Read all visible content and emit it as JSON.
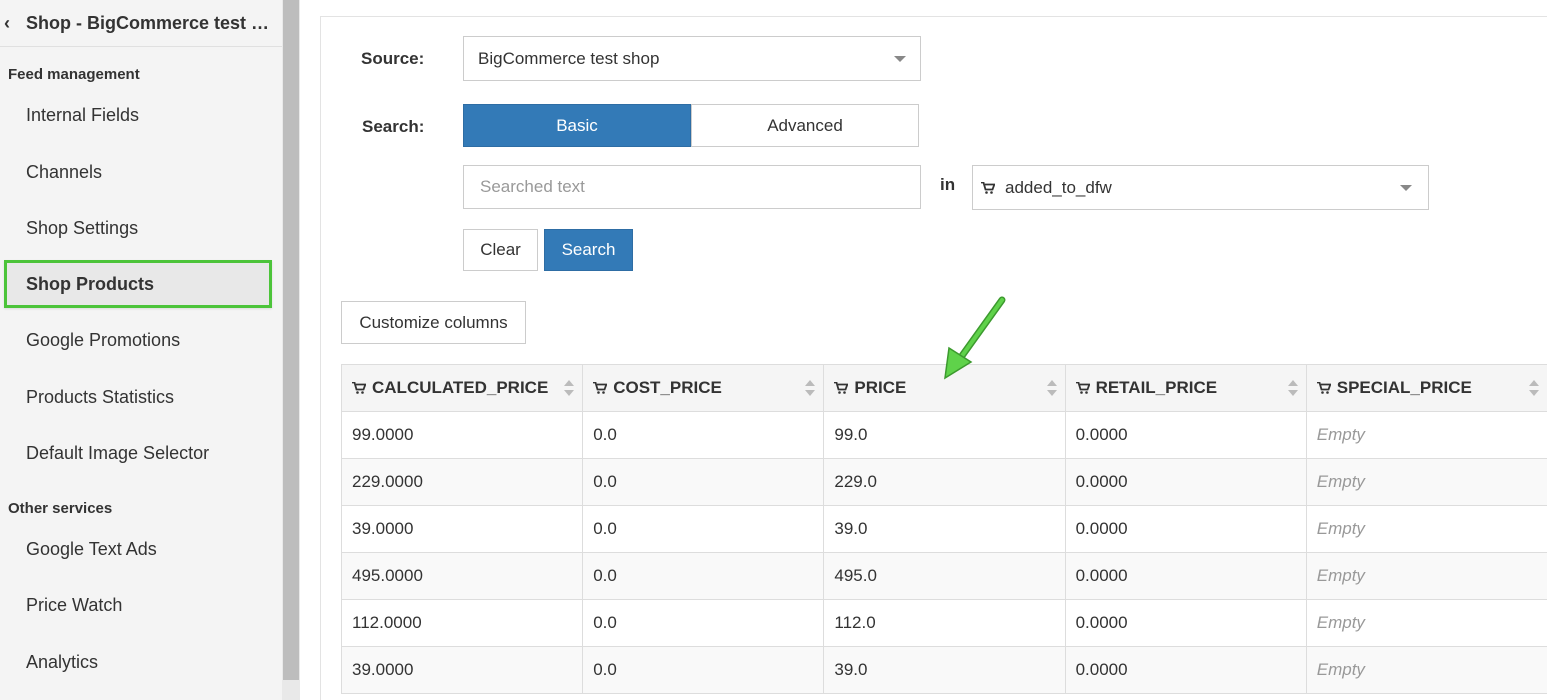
{
  "sidebar": {
    "shop_title": "Shop - BigCommerce test shop",
    "sections": [
      {
        "title": "Feed management",
        "items": [
          "Internal Fields",
          "Channels",
          "Shop Settings",
          "Shop Products",
          "Google Promotions",
          "Products Statistics",
          "Default Image Selector"
        ]
      },
      {
        "title": "Other services",
        "items": [
          "Google Text Ads",
          "Price Watch",
          "Analytics"
        ]
      }
    ],
    "active_item": "Shop Products"
  },
  "form": {
    "source_label": "Source:",
    "source_value": "BigCommerce test shop",
    "search_label": "Search:",
    "search_modes": [
      "Basic",
      "Advanced"
    ],
    "search_mode_selected": "Basic",
    "search_placeholder": "Searched text",
    "in_label": "in",
    "field_value": "added_to_dfw",
    "clear_label": "Clear",
    "search_button_label": "Search"
  },
  "customize_label": "Customize columns",
  "table": {
    "columns": [
      "CALCULATED_PRICE",
      "COST_PRICE",
      "PRICE",
      "RETAIL_PRICE",
      "SPECIAL_PRICE"
    ],
    "rows": [
      [
        "99.0000",
        "0.0",
        "99.0",
        "0.0000",
        "Empty"
      ],
      [
        "229.0000",
        "0.0",
        "229.0",
        "0.0000",
        "Empty"
      ],
      [
        "39.0000",
        "0.0",
        "39.0",
        "0.0000",
        "Empty"
      ],
      [
        "495.0000",
        "0.0",
        "495.0",
        "0.0000",
        "Empty"
      ],
      [
        "112.0000",
        "0.0",
        "112.0",
        "0.0000",
        "Empty"
      ],
      [
        "39.0000",
        "0.0",
        "39.0",
        "0.0000",
        "Empty"
      ]
    ]
  },
  "icons": {
    "back": "chevron-left-icon",
    "cart": "shopping-cart-icon",
    "sort": "sort-icon",
    "annotation": "green-arrow-icon"
  },
  "colors": {
    "primary": "#337ab7",
    "highlight": "#4cc43a"
  }
}
